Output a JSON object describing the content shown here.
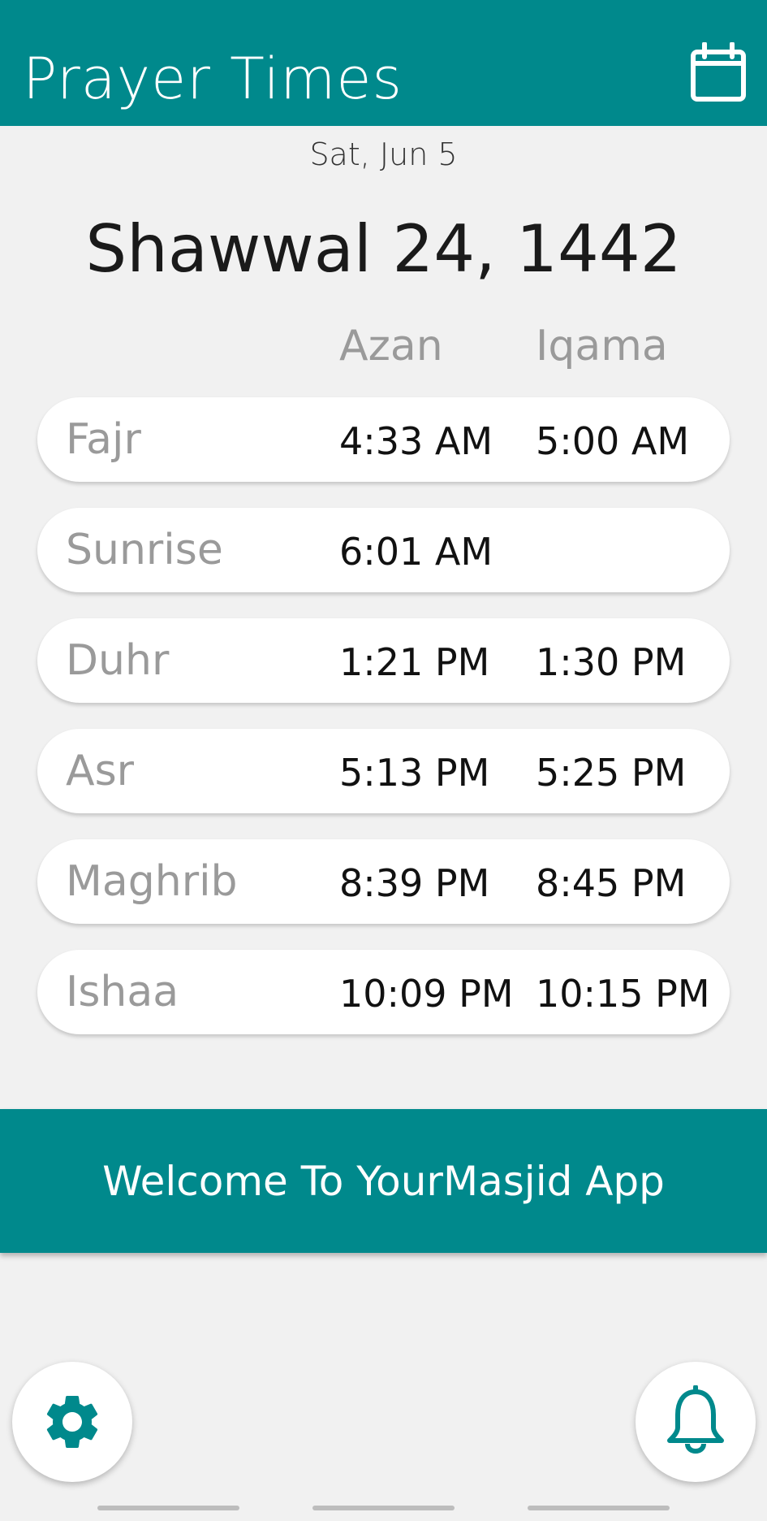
{
  "appbar": {
    "title": "Prayer Times",
    "calendar_icon": "calendar-icon",
    "background": "#00898c"
  },
  "dates": {
    "gregorian": "Sat, Jun 5",
    "hijri": "Shawwal 24, 1442"
  },
  "columns": {
    "azan": "Azan",
    "iqama": "Iqama"
  },
  "prayers": [
    {
      "name": "Fajr",
      "azan": "4:33 AM",
      "iqama": "5:00 AM"
    },
    {
      "name": "Sunrise",
      "azan": "6:01 AM",
      "iqama": ""
    },
    {
      "name": "Duhr",
      "azan": "1:21 PM",
      "iqama": "1:30 PM"
    },
    {
      "name": "Asr",
      "azan": "5:13 PM",
      "iqama": "5:25 PM"
    },
    {
      "name": "Maghrib",
      "azan": "8:39 PM",
      "iqama": "8:45 PM"
    },
    {
      "name": "Ishaa",
      "azan": "10:09 PM",
      "iqama": "10:15 PM"
    }
  ],
  "banner": {
    "text": "Welcome To YourMasjid App"
  },
  "fabs": {
    "settings_icon": "gear-icon",
    "notify_icon": "bell-icon",
    "icon_color": "#00898c"
  }
}
